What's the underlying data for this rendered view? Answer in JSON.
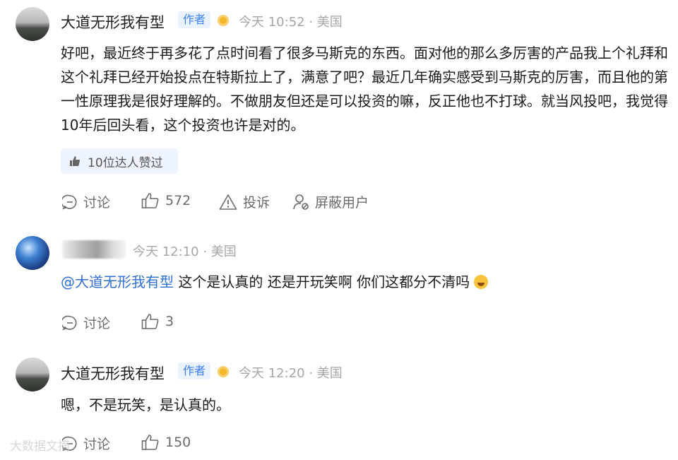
{
  "comments": [
    {
      "name": "大道无形我有型",
      "badge": "作者",
      "meta": "今天 10:52 · 美国",
      "text": "好吧，最近终于再多花了点时间看了很多马斯克的东西。面对他的那么多厉害的产品我上个礼拜和这个礼拜已经开始投点在特斯拉上了，满意了吧？最近几年确实感受到马斯克的厉害，而且他的第一性原理我是很好理解的。不做朋友但还是可以投资的嘛，反正他也不打球。就当风投吧，我觉得10年后回头看，这个投资也许是对的。",
      "liked_by": "10位达人赞过",
      "actions": {
        "discuss": "讨论",
        "likes": "572",
        "report": "投诉",
        "block": "屏蔽用户"
      }
    },
    {
      "meta": "今天 12:10 · 美国",
      "mention": "@大道无形我有型",
      "text": " 这个是认真的 还是开玩笑啊 你们这都分不清吗",
      "actions": {
        "discuss": "讨论",
        "likes": "3"
      }
    },
    {
      "name": "大道无形我有型",
      "badge": "作者",
      "meta": "今天 12:20 · 美国",
      "text": "嗯，不是玩笑，是认真的。",
      "actions": {
        "discuss": "讨论",
        "likes": "150"
      }
    }
  ],
  "watermark": "大数据文摘"
}
